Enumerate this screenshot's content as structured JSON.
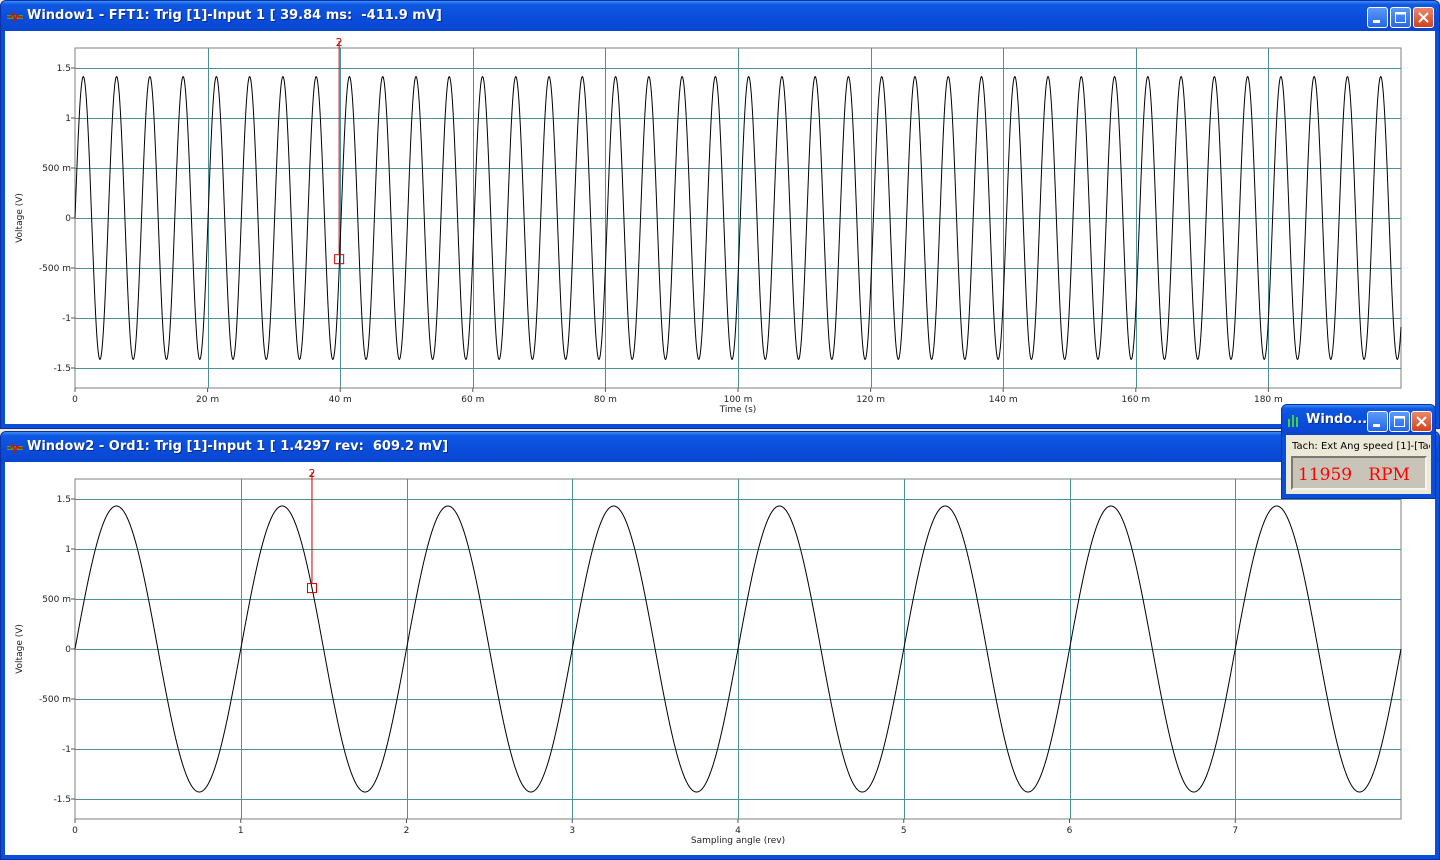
{
  "windows": [
    {
      "id": "w1",
      "title": "Window1 - FFT1: Trig [1]-Input 1 [ 39.84 ms:  -411.9 mV]",
      "chart_data": {
        "type": "line",
        "xlabel": "Time (s)",
        "ylabel": "Voltage (V)",
        "xlim": [
          0,
          0.2
        ],
        "ylim": [
          -1.7,
          1.7
        ],
        "xticks": [
          0,
          0.02,
          0.04,
          0.06,
          0.08,
          0.1,
          0.12,
          0.14,
          0.16,
          0.18
        ],
        "xtick_labels": [
          "0",
          "20 m",
          "40 m",
          "60 m",
          "80 m",
          "100 m",
          "120 m",
          "140 m",
          "160 m",
          "180 m"
        ],
        "yticks": [
          -1.5,
          -1,
          -0.5,
          0,
          0.5,
          1,
          1.5
        ],
        "ytick_labels": [
          "-1.5",
          "-1",
          "-500 m",
          "0",
          "500 m",
          "1",
          "1.5"
        ],
        "grid": true,
        "series": [
          {
            "function": "sine",
            "amplitude": 1.414,
            "cycles_per_x_unit": 199.3,
            "phase_deg": 0,
            "x_start": 0,
            "x_end": 0.2
          }
        ],
        "cursor": {
          "label": "2",
          "x": 0.03984,
          "y": -0.4119
        }
      }
    },
    {
      "id": "w2",
      "title": "Window2 - Ord1: Trig [1]-Input 1 [ 1.4297 rev:  609.2 mV]",
      "chart_data": {
        "type": "line",
        "xlabel": "Sampling angle (rev)",
        "ylabel": "Voltage (V)",
        "xlim": [
          0,
          8
        ],
        "ylim": [
          -1.7,
          1.7
        ],
        "xticks": [
          0,
          1,
          2,
          3,
          4,
          5,
          6,
          7
        ],
        "xtick_labels": [
          "0",
          "1",
          "2",
          "3",
          "4",
          "5",
          "6",
          "7"
        ],
        "yticks": [
          -1.5,
          -1,
          -0.5,
          0,
          0.5,
          1,
          1.5
        ],
        "ytick_labels": [
          "-1.5",
          "-1",
          "-500 m",
          "0",
          "500 m",
          "1",
          "1.5"
        ],
        "grid": true,
        "series": [
          {
            "function": "sine",
            "amplitude": 1.43,
            "cycles_per_x_unit": 1,
            "phase_deg": 0,
            "x_start": 0,
            "x_end": 8
          }
        ],
        "cursor": {
          "label": "2",
          "x": 1.4297,
          "y": 0.6092
        }
      }
    }
  ],
  "tach_window": {
    "title": "Windo...",
    "label": "Tach: Ext Ang speed [1]-[Tac",
    "value": "11959   RPM"
  },
  "colors": {
    "titlebar": "#0a4ddb",
    "grid": "#4f8f9a",
    "trace": "#000000",
    "cursor": "#cc0000",
    "tach_value": "#ff0000"
  }
}
